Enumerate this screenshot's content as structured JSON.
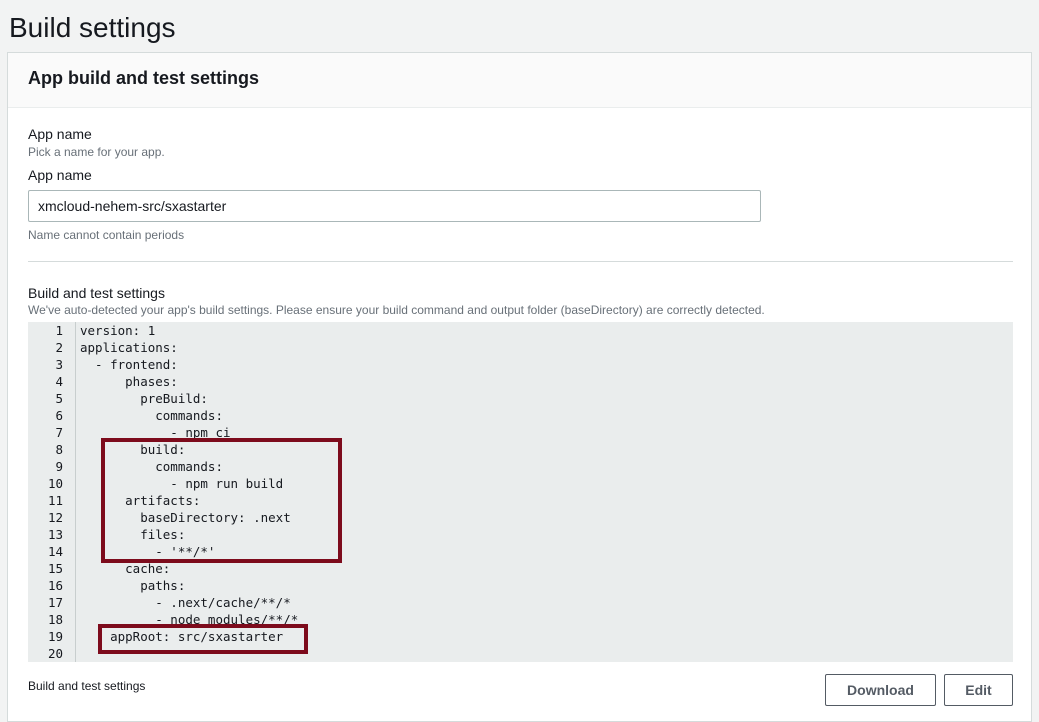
{
  "page": {
    "title": "Build settings"
  },
  "panel": {
    "title": "App build and test settings"
  },
  "app_name_section": {
    "label": "App name",
    "description": "Pick a name for your app.",
    "field_label": "App name",
    "input_value": "xmcloud-nehem-src/sxastarter",
    "constraint": "Name cannot contain periods"
  },
  "build_section": {
    "label": "Build and test settings",
    "description": "We've auto-detected your app's build settings. Please ensure your build command and output folder (baseDirectory) are correctly detected.",
    "lines": [
      {
        "num": "1",
        "text": "version: 1"
      },
      {
        "num": "2",
        "text": "applications:"
      },
      {
        "num": "3",
        "text": "  - frontend:"
      },
      {
        "num": "4",
        "text": "      phases:"
      },
      {
        "num": "5",
        "text": "        preBuild:"
      },
      {
        "num": "6",
        "text": "          commands:"
      },
      {
        "num": "7",
        "text": "            - npm ci"
      },
      {
        "num": "8",
        "text": "        build:"
      },
      {
        "num": "9",
        "text": "          commands:"
      },
      {
        "num": "10",
        "text": "            - npm run build"
      },
      {
        "num": "11",
        "text": "      artifacts:"
      },
      {
        "num": "12",
        "text": "        baseDirectory: .next"
      },
      {
        "num": "13",
        "text": "        files:"
      },
      {
        "num": "14",
        "text": "          - '**/*'"
      },
      {
        "num": "15",
        "text": "      cache:"
      },
      {
        "num": "16",
        "text": "        paths:"
      },
      {
        "num": "17",
        "text": "          - .next/cache/**/*"
      },
      {
        "num": "18",
        "text": "          - node_modules/**/*"
      },
      {
        "num": "19",
        "text": "    appRoot: src/sxastarter"
      },
      {
        "num": "20",
        "text": ""
      }
    ]
  },
  "footer": {
    "label": "Build and test settings",
    "download_label": "Download",
    "edit_label": "Edit"
  },
  "colors": {
    "highlight": "#7d0b1c",
    "editor_bg": "#eaeded"
  }
}
